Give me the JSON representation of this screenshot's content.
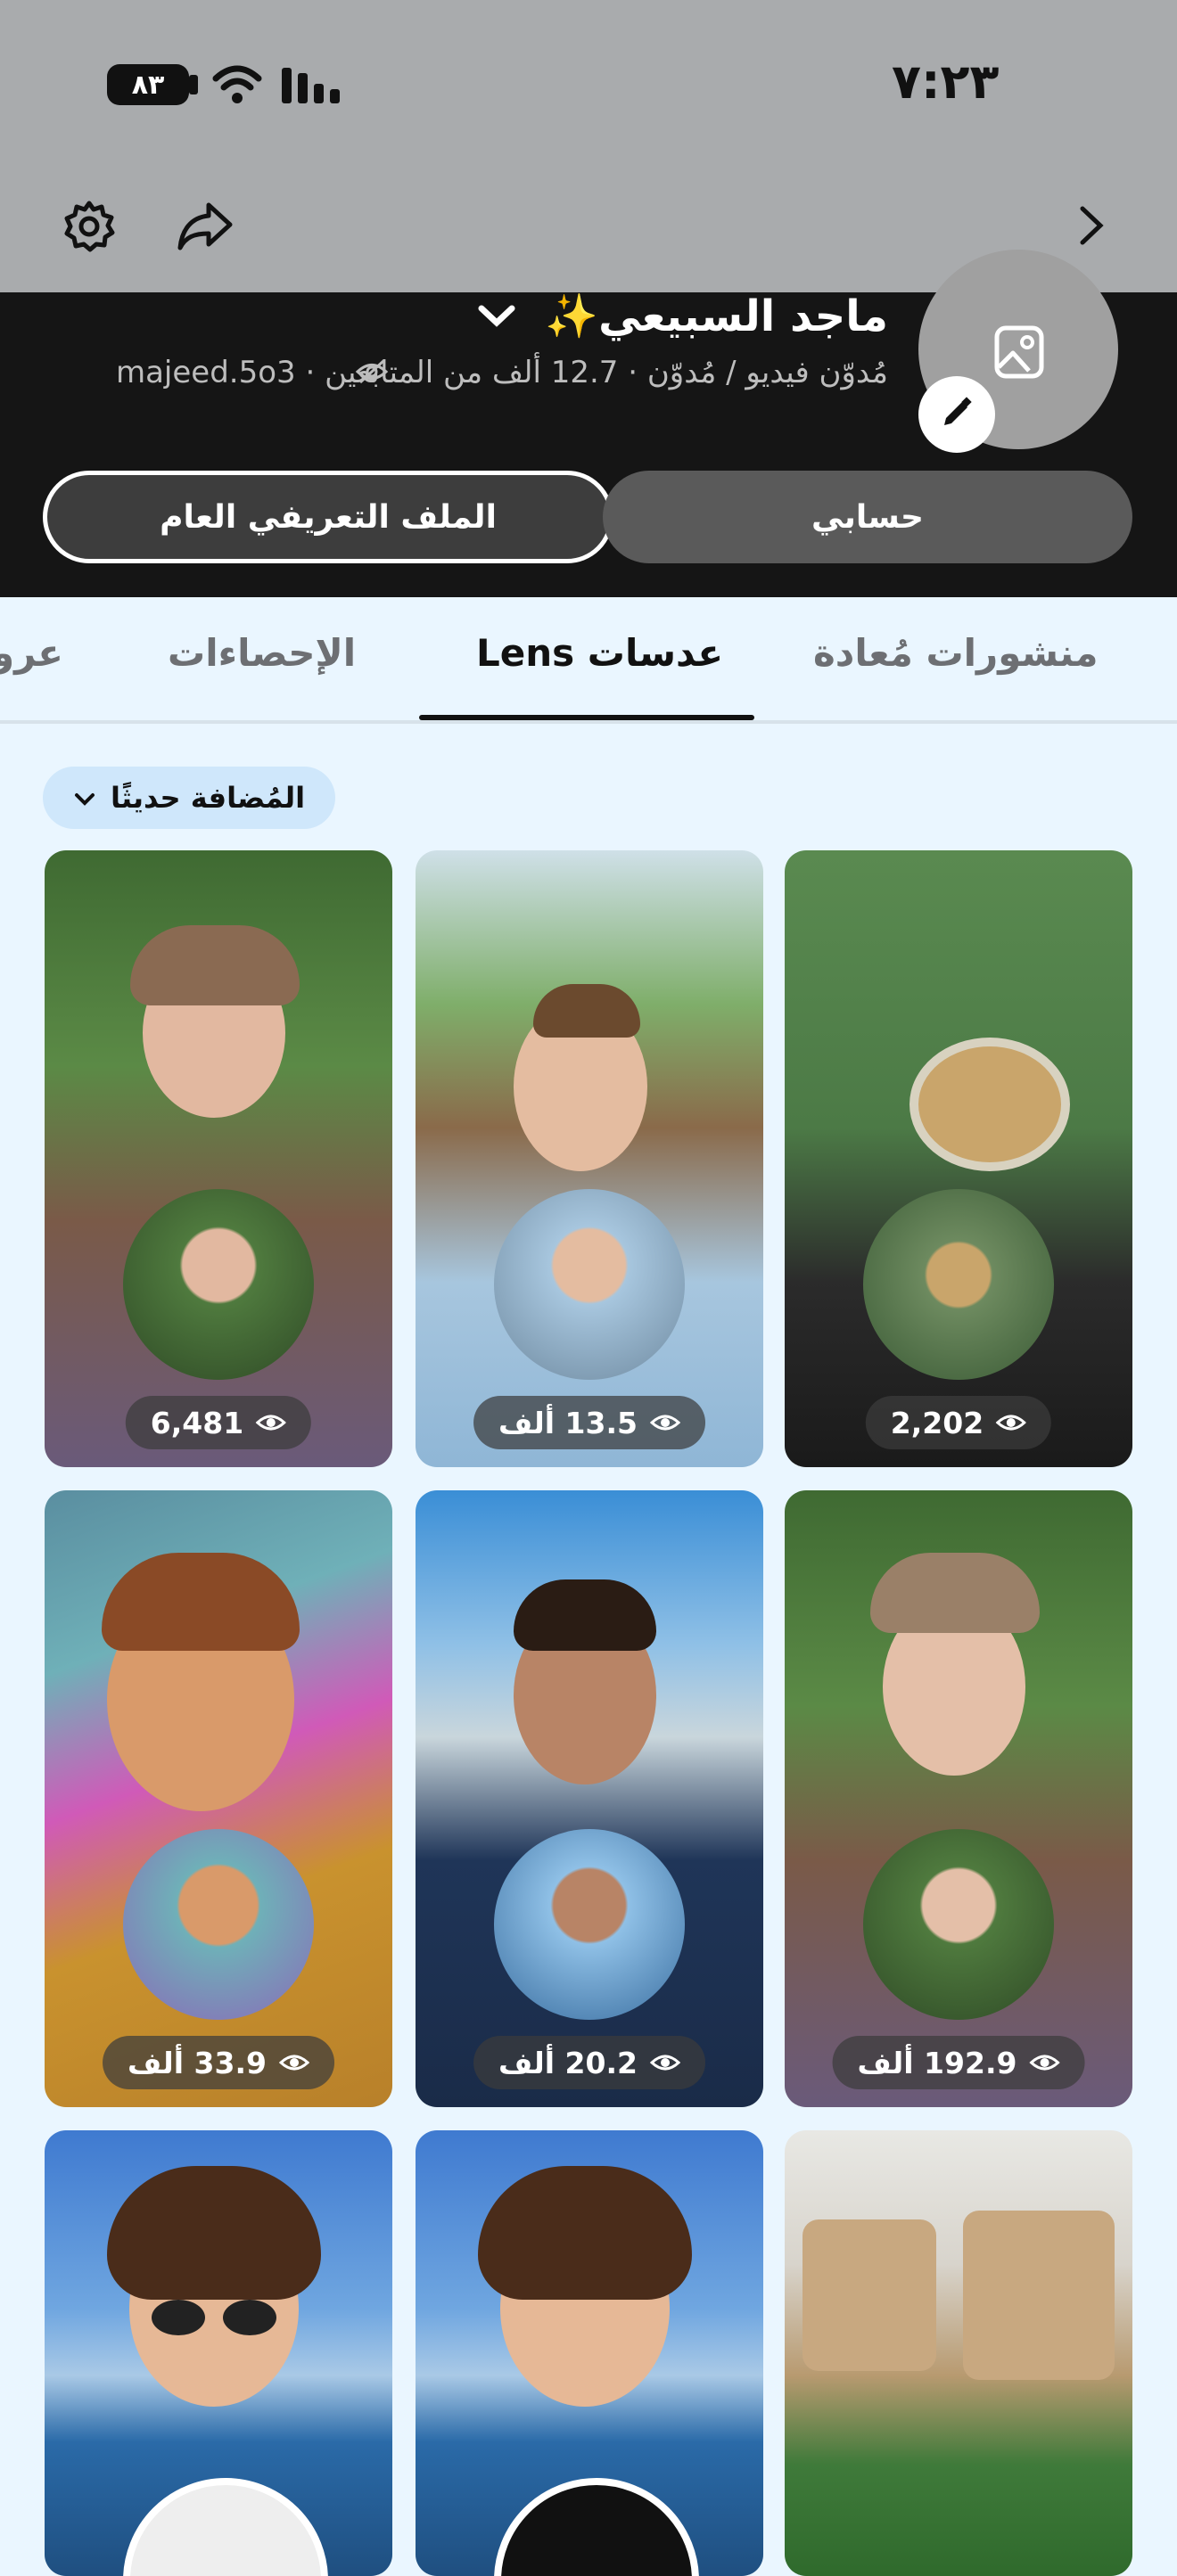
{
  "status_bar": {
    "time": "٧:٢٣",
    "battery": "٨٣"
  },
  "profile": {
    "name": "ماجد السبيعي✨",
    "subtitle": "مُدوّن فيديو / مُدوّن · 12.7 ألف من المتابعين · majeed.5o3",
    "public_profile_label": "الملف التعريفي العام",
    "account_label": "حسابي"
  },
  "tabs": [
    {
      "label": "منشورات مُعادة",
      "active": false
    },
    {
      "label": "عدسات Lens",
      "active": true
    },
    {
      "label": "الإحصاءات",
      "active": false
    },
    {
      "label": "عرو",
      "active": false
    }
  ],
  "sort": {
    "label": "المُضافة حديثًا"
  },
  "grid": [
    {
      "views": "2,202",
      "theme": "coffee"
    },
    {
      "views": "13.5 ألف",
      "theme": "lanterns"
    },
    {
      "views": "6,481",
      "theme": "garden"
    },
    {
      "views": "192.9 ألف",
      "theme": "garden"
    },
    {
      "views": "20.2 ألف",
      "theme": "city"
    },
    {
      "views": "33.9 ألف",
      "theme": "cartoon"
    },
    {
      "views": "",
      "theme": "patio"
    },
    {
      "views": "",
      "theme": "beach"
    },
    {
      "views": "",
      "theme": "beach"
    }
  ],
  "colors": {
    "dark_header": "#151515",
    "tab_active": "#111111",
    "background": "#eaf6ff"
  },
  "icons": [
    "gear-icon",
    "share-icon",
    "chevron-right-icon",
    "chevron-down-icon",
    "image-icon",
    "pencil-icon",
    "eye-icon",
    "hidden-eye-icon",
    "wifi-icon",
    "signal-icon"
  ]
}
